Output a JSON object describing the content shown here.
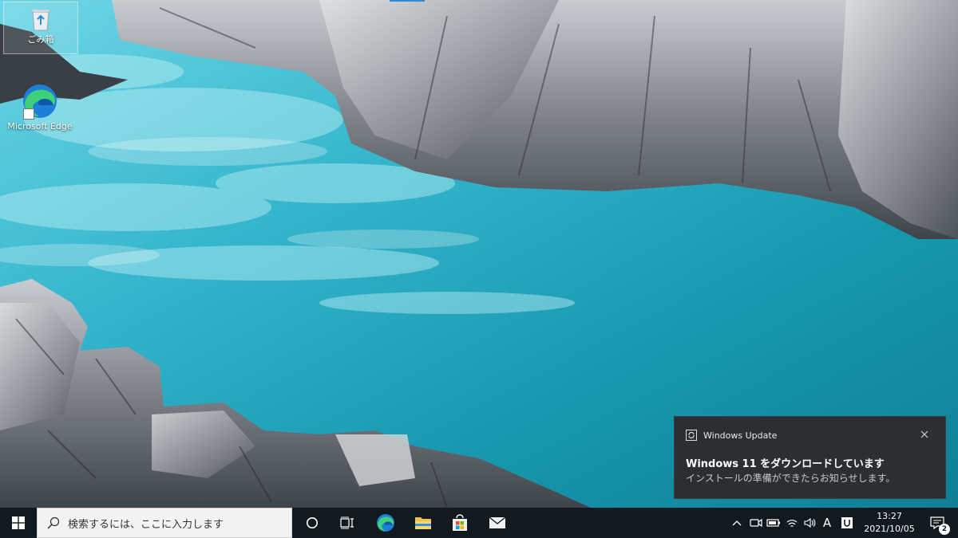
{
  "desktop": {
    "icons": [
      {
        "label": "ごみ箱",
        "icon": "recycle-bin-icon"
      },
      {
        "label": "Microsoft Edge",
        "icon": "edge-icon"
      }
    ]
  },
  "toast": {
    "app_name": "Windows Update",
    "title": "Windows 11 をダウンロードしています",
    "body": "インストールの準備ができたらお知らせします。",
    "icon": "sync-icon"
  },
  "taskbar": {
    "search_placeholder": "検索するには、ここに入力します",
    "pinned": [
      "cortana-icon",
      "task-view-icon",
      "edge-icon",
      "file-explorer-icon",
      "store-icon",
      "mail-icon"
    ],
    "tray": {
      "ime_label": "A",
      "clock_time": "13:27",
      "clock_date": "2021/10/05",
      "notification_count": "2"
    }
  },
  "colors": {
    "taskbar_bg": "#131a1f",
    "toast_bg": "#2b2f31",
    "accent": "#2e8ad8"
  }
}
